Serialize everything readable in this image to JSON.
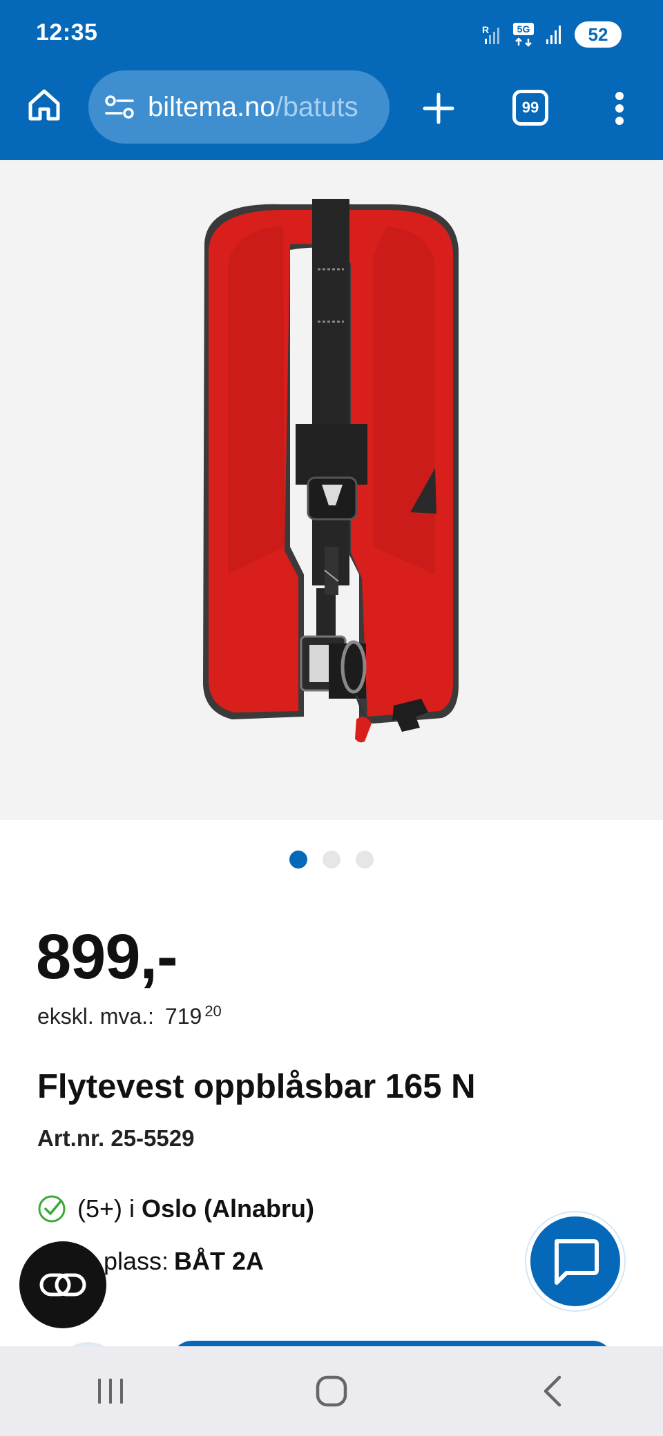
{
  "status_bar": {
    "time": "12:35",
    "network_label": "5G",
    "roaming_label": "R",
    "battery": "52"
  },
  "browser": {
    "url_host": "biltema.no",
    "url_path": "/batuts",
    "tab_count": "99"
  },
  "gallery": {
    "image_alt": "Flytevest oppblåsbar 165 N",
    "dots": 3,
    "active_index": 0
  },
  "product": {
    "price": "899,-",
    "ex_vat_label": "ekskl. mva.:",
    "ex_vat_int": "719",
    "ex_vat_dec": "20",
    "title": "Flytevest oppblåsbar 165 N",
    "art_nr": "Art.nr. 25-5529",
    "stock_count": "(5+) i",
    "stock_city": "Oslo (Alnabru)",
    "location_label": "plass:",
    "location_value": "BÅT 2A"
  },
  "colors": {
    "brand_blue": "#0568b8",
    "vest_red": "#d81f1c",
    "check_green": "#3aaa35"
  },
  "icons": {
    "home": "home-icon",
    "tune": "tune-icon",
    "plus": "plus-icon",
    "tabs": "tabs-icon",
    "menu": "more-vert-icon",
    "check": "check-circle-icon",
    "chat": "chat-icon",
    "link": "link-icon"
  },
  "system_nav": {
    "recents": "recents-icon",
    "home": "home-circle-icon",
    "back": "back-icon"
  }
}
